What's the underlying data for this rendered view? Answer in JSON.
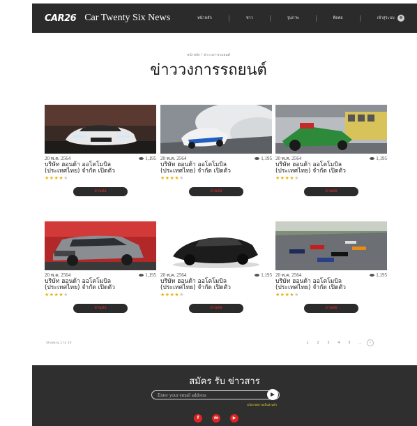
{
  "header": {
    "logo": "CAR26",
    "site_title": "Car Twenty Six News",
    "nav": [
      "หน้าหลัก",
      "ข่าว",
      "รูปภาพ",
      "ติดต่อ"
    ],
    "login_label": "เข้าสู่ระบบ"
  },
  "breadcrumb": "หน้าหลัก / ข่าววงการรถยนต์",
  "page_title": "ข่าววงการรถยนต์",
  "cards": [
    {
      "date": "20 พ.ค. 2564",
      "views": "1,195",
      "title_line1": "บริษัท ฮอนด้า ออโตโมบิล",
      "title_line2": "(ประเทศไทย) จำกัด เปิดตัว",
      "rating": 4,
      "button": "อ่านต่อ",
      "image": "white-honda-sedan"
    },
    {
      "date": "20 พ.ค. 2564",
      "views": "1,195",
      "title_line1": "บริษัท ฮอนด้า ออโตโมบิล",
      "title_line2": "(ประเทศไทย) จำกัด เปิดตัว",
      "rating": 4,
      "button": "อ่านต่อ",
      "image": "drifting-race-car"
    },
    {
      "date": "20 พ.ค. 2564",
      "views": "1,195",
      "title_line1": "บริษัท ฮอนด้า ออโตโมบิล",
      "title_line2": "(ประเทศไทย) จำกัด เปิดตัว",
      "rating": 4,
      "button": "อ่านต่อ",
      "image": "dragster-race-car"
    },
    {
      "date": "20 พ.ค. 2564",
      "views": "1,195",
      "title_line1": "บริษัท ฮอนด้า ออโตโมบิล",
      "title_line2": "(ประเทศไทย) จำกัด เปิดตัว",
      "rating": 4,
      "button": "อ่านต่อ",
      "image": "grey-suv"
    },
    {
      "date": "20 พ.ค. 2564",
      "views": "1,195",
      "title_line1": "บริษัท ฮอนด้า ออโตโมบิล",
      "title_line2": "(ประเทศไทย) จำกัด เปิดตัว",
      "rating": 4,
      "button": "อ่านต่อ",
      "image": "black-hatchback"
    },
    {
      "date": "20 พ.ค. 2564",
      "views": "1,195",
      "title_line1": "บริษัท ฮอนด้า ออโตโมบิล",
      "title_line2": "(ประเทศไทย) จำกัด เปิดตัว",
      "rating": 4,
      "button": "อ่านต่อ",
      "image": "formula-one-race"
    }
  ],
  "showing_text": "Showing 1 to 10",
  "pagination": {
    "pages": [
      "1",
      "2",
      "3",
      "4",
      "5",
      "..."
    ],
    "next": "›"
  },
  "newsletter": {
    "title": "สมัคร รับ ข่าวสาร",
    "email_placeholder": "Enter your email address",
    "policy": "นโยบายความเป็นส่วนตัว",
    "socials": [
      {
        "icon": "facebook-icon",
        "glyph": "f"
      },
      {
        "icon": "messenger-icon",
        "glyph": "m"
      },
      {
        "icon": "youtube-icon",
        "glyph": "▶"
      }
    ]
  },
  "colors": {
    "header_bg": "#2b2b2b",
    "accent_red": "#e02424",
    "button_text": "#e53030",
    "star": "#e7b20f",
    "footer_bg": "#2f2f2f"
  }
}
